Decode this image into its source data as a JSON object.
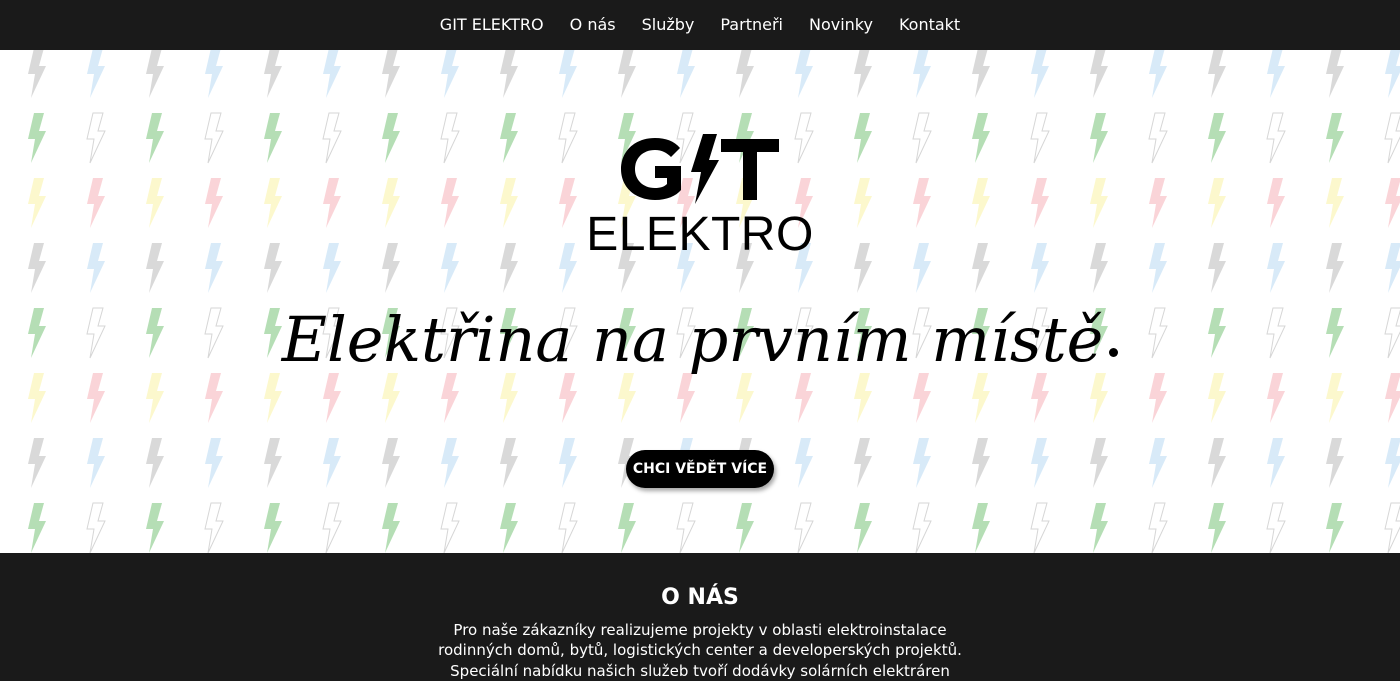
{
  "nav": {
    "items": [
      {
        "label": "GIT ELEKTRO"
      },
      {
        "label": "O nás"
      },
      {
        "label": "Služby"
      },
      {
        "label": "Partneři"
      },
      {
        "label": "Novinky"
      },
      {
        "label": "Kontakt"
      }
    ]
  },
  "hero": {
    "logo_top": "GIT",
    "logo_bottom": "ELEKTRO",
    "tagline": "Elektřina na prvním místě",
    "cta_label": "CHCI VĚDĚT VÍCE",
    "background_pattern": "lightning-bolt-icon",
    "bolt_colors": [
      "#aaaaaa",
      "#f5a0a8",
      "#a8d8a8",
      "#a8d0f0",
      "#f8f090"
    ]
  },
  "about": {
    "heading": "O NÁS",
    "lines": [
      "Pro naše zákazníky realizujeme projekty v oblasti elektroinstalace",
      "rodinných domů, bytů, logistických center a developerských projektů.",
      "Speciální nabídku našich služeb tvoří dodávky solárních elektráren"
    ]
  },
  "colors": {
    "nav_background": "#1a1a1a",
    "accent": "#000000",
    "text_light": "#ffffff"
  }
}
